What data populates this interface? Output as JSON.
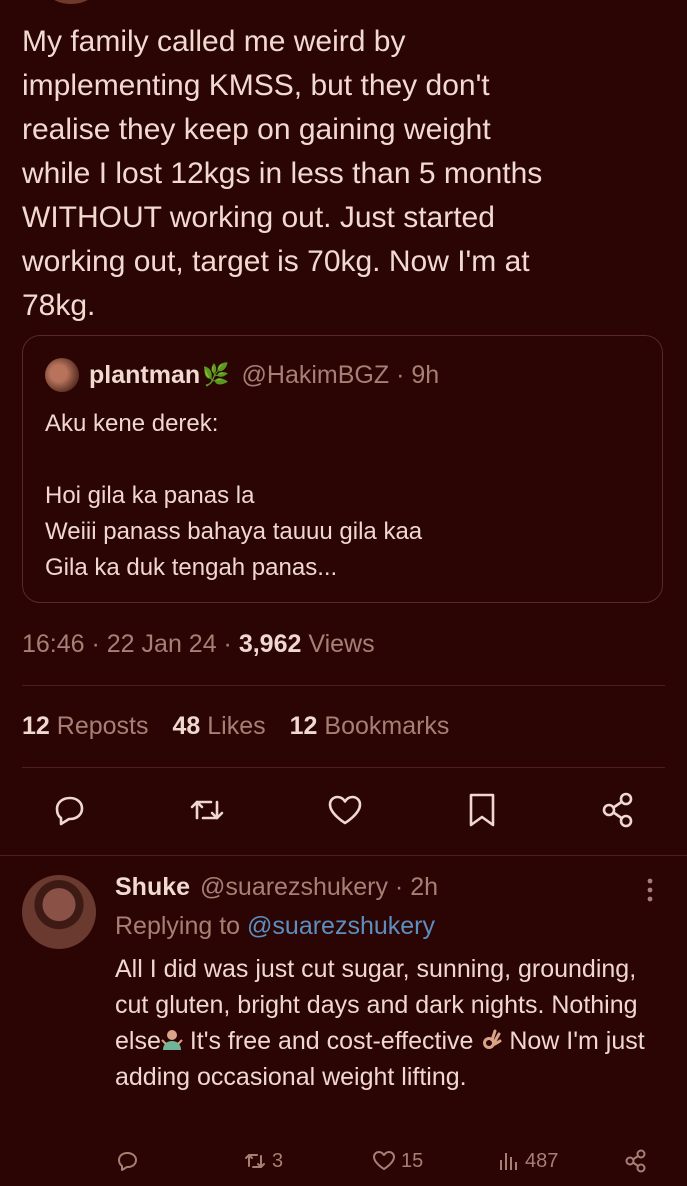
{
  "tweet": {
    "text": "My family called me weird by\nimplementing KMSS, but they don't\nrealise they keep on gaining weight\nwhile I lost 12kgs in less than 5 months\nWITHOUT working out. Just started\nworking out, target is 70kg. Now I'm at\n78kg.",
    "time": "16:46",
    "date": "22 Jan 24",
    "views_count": "3,962",
    "views_label": "Views"
  },
  "quote": {
    "name": "plantman",
    "leaf_icon": "🌿",
    "handle": "@HakimBGZ",
    "age": "9h",
    "text": "Aku kene derek:\n\nHoi gila ka panas la\nWeiii panass bahaya tauuu gila kaa\nGila ka duk tengah panas..."
  },
  "stats": {
    "reposts_count": "12",
    "reposts_label": "Reposts",
    "likes_count": "48",
    "likes_label": "Likes",
    "bookmarks_count": "12",
    "bookmarks_label": "Bookmarks"
  },
  "actions": [
    "reply-icon",
    "repost-icon",
    "like-icon",
    "bookmark-icon",
    "share-icon"
  ],
  "reply": {
    "name": "Shuke",
    "handle": "@suarezshukery",
    "age": "2h",
    "replying_label": "Replying to",
    "replying_handle": "@suarezshukery",
    "text_part1": "All I did was just cut sugar, sunning, grounding, cut gluten, bright days and dark nights. Nothing else",
    "text_part2": " It's free and cost-effective ",
    "text_part3": " Now I'm just adding occasional weight lifting.",
    "emoji1": "shrug-emoji",
    "emoji2": "ok-hand-emoji",
    "reposts": "3",
    "likes": "15",
    "views": "487"
  },
  "colors": {
    "background": "#2b0404",
    "text": "#efd8cd",
    "muted": "#a77f74",
    "link": "#5b8fc0"
  }
}
